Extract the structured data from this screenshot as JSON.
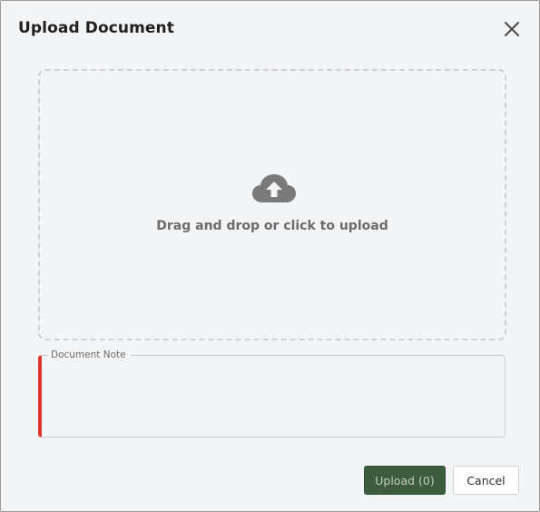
{
  "dialog": {
    "title": "Upload Document",
    "close_icon": "close-icon"
  },
  "dropzone": {
    "icon": "cloud-upload-icon",
    "label": "Drag and drop or click to upload"
  },
  "note": {
    "label": "Document Note",
    "value": "",
    "error_color": "#e0352b"
  },
  "actions": {
    "upload_label": "Upload (0)",
    "cancel_label": "Cancel"
  },
  "colors": {
    "primary": "#3d5c3f",
    "background": "#f3f4f6",
    "icon": "#7a7a7a"
  }
}
